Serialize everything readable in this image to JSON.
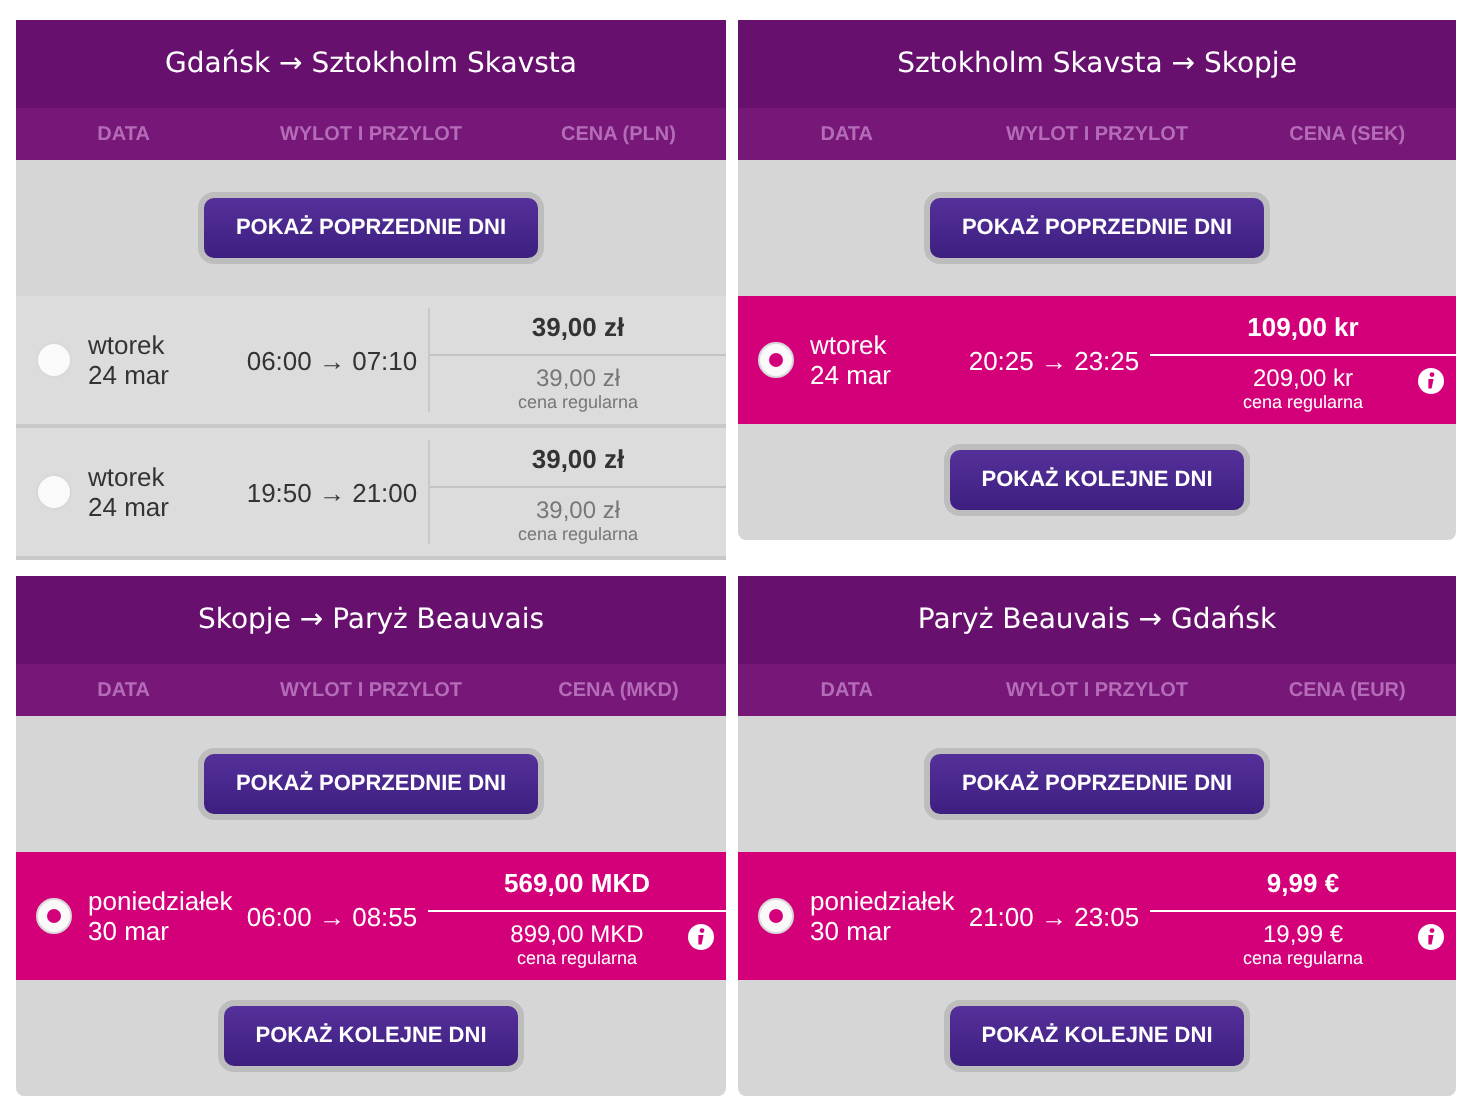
{
  "panels": [
    {
      "title": "Gdańsk → Sztokholm Skavsta",
      "columns": [
        "DATA",
        "WYLOT I PRZYLOT",
        "CENA (PLN)"
      ],
      "prev_button": "POKAŻ POPRZEDNIE DNI",
      "flights": [
        {
          "day": "wtorek",
          "date": "24 mar",
          "times": "06:00 → 07:10",
          "price": "39,00 zł",
          "regular_price": "39,00 zł",
          "regular_label": "cena regularna",
          "selected": false
        },
        {
          "day": "wtorek",
          "date": "24 mar",
          "times": "19:50 → 21:00",
          "price": "39,00 zł",
          "regular_price": "39,00 zł",
          "regular_label": "cena regularna",
          "selected": false
        }
      ]
    },
    {
      "title": "Sztokholm Skavsta → Skopje",
      "columns": [
        "DATA",
        "WYLOT I PRZYLOT",
        "CENA (SEK)"
      ],
      "prev_button": "POKAŻ POPRZEDNIE DNI",
      "flights": [
        {
          "day": "wtorek",
          "date": "24 mar",
          "times": "20:25 → 23:25",
          "price": "109,00 kr",
          "regular_price": "209,00 kr",
          "regular_label": "cena regularna",
          "selected": true
        }
      ],
      "next_button": "POKAŻ KOLEJNE DNI"
    },
    {
      "title": "Skopje → Paryż Beauvais",
      "columns": [
        "DATA",
        "WYLOT I PRZYLOT",
        "CENA (MKD)"
      ],
      "prev_button": "POKAŻ POPRZEDNIE DNI",
      "flights": [
        {
          "day": "poniedziałek",
          "date": "30 mar",
          "times": "06:00 → 08:55",
          "price": "569,00 MKD",
          "regular_price": "899,00 MKD",
          "regular_label": "cena regularna",
          "selected": true
        }
      ],
      "next_button": "POKAŻ KOLEJNE DNI"
    },
    {
      "title": "Paryż Beauvais → Gdańsk",
      "columns": [
        "DATA",
        "WYLOT I PRZYLOT",
        "CENA (EUR)"
      ],
      "prev_button": "POKAŻ POPRZEDNIE DNI",
      "flights": [
        {
          "day": "poniedziałek",
          "date": "30 mar",
          "times": "21:00 → 23:05",
          "price": "9,99 €",
          "regular_price": "19,99 €",
          "regular_label": "cena regularna",
          "selected": true
        }
      ],
      "next_button": "POKAŻ KOLEJNE DNI"
    }
  ]
}
